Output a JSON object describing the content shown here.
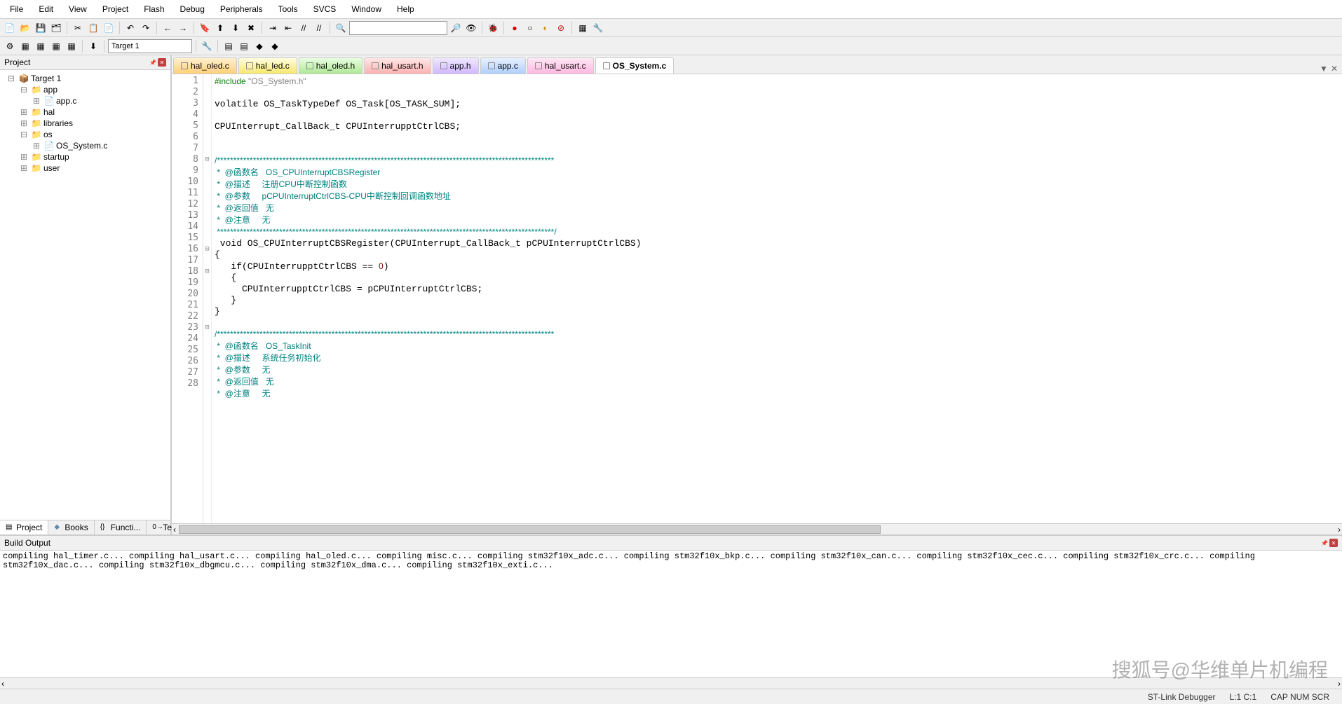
{
  "menu": {
    "items": [
      "File",
      "Edit",
      "View",
      "Project",
      "Flash",
      "Debug",
      "Peripherals",
      "Tools",
      "SVCS",
      "Window",
      "Help"
    ]
  },
  "toolbar1": {
    "labels": [
      "new",
      "open",
      "save",
      "saveall",
      "cut",
      "copy",
      "paste",
      "undo",
      "redo",
      "back",
      "fwd",
      "bookmark",
      "prev-bm",
      "next-bm",
      "clear-bm",
      "indent",
      "outdent",
      "comment",
      "uncomment",
      "find"
    ]
  },
  "toolbar2": {
    "target_combo": "Target 1"
  },
  "project": {
    "title": "Project",
    "root": "Target 1",
    "nodes": [
      {
        "lvl": 1,
        "label": "Target 1",
        "icon": "📦",
        "exp": "⊟"
      },
      {
        "lvl": 2,
        "label": "app",
        "icon": "📁",
        "exp": "⊟"
      },
      {
        "lvl": 3,
        "label": "app.c",
        "icon": "📄",
        "exp": "⊞"
      },
      {
        "lvl": 2,
        "label": "hal",
        "icon": "📁",
        "exp": "⊞"
      },
      {
        "lvl": 2,
        "label": "libraries",
        "icon": "📁",
        "exp": "⊞"
      },
      {
        "lvl": 2,
        "label": "os",
        "icon": "📁",
        "exp": "⊟"
      },
      {
        "lvl": 3,
        "label": "OS_System.c",
        "icon": "📄",
        "exp": "⊞"
      },
      {
        "lvl": 2,
        "label": "startup",
        "icon": "📁",
        "exp": "⊞"
      },
      {
        "lvl": 2,
        "label": "user",
        "icon": "📁",
        "exp": "⊞"
      }
    ],
    "bottom_tabs": [
      {
        "label": "Project",
        "active": true
      },
      {
        "label": "Books",
        "active": false
      },
      {
        "label": "Functi...",
        "active": false
      },
      {
        "label": "Templa...",
        "active": false
      }
    ]
  },
  "editor": {
    "tabs": [
      {
        "label": "hal_oled.c",
        "color": "c-orange"
      },
      {
        "label": "hal_led.c",
        "color": "c-yellow"
      },
      {
        "label": "hal_oled.h",
        "color": "c-green"
      },
      {
        "label": "hal_usart.h",
        "color": "c-red"
      },
      {
        "label": "app.h",
        "color": "c-purple"
      },
      {
        "label": "app.c",
        "color": "c-blue"
      },
      {
        "label": "hal_usart.c",
        "color": "c-pink"
      },
      {
        "label": "OS_System.c",
        "color": "c-grey",
        "active": true
      }
    ],
    "lines": 28,
    "fold": [
      "",
      "",
      "",
      "",
      "",
      "",
      "",
      "⊟",
      "",
      "",
      "",
      "",
      "",
      "",
      "",
      "⊟",
      "",
      "⊟",
      "",
      "",
      "",
      "",
      "⊟",
      "",
      "",
      "",
      "",
      ""
    ],
    "code": {
      "l1_pp": "#include",
      "l1_str": " \"OS_System.h\"",
      "l3": "volatile OS_TaskTypeDef OS_Task[OS_TASK_SUM];",
      "l5": "CPUInterrupt_CallBack_t CPUInterrupptCtrlCBS;",
      "l8": "/*******************************************************************************************************",
      "l9": " *  @函数名   OS_CPUInterruptCBSRegister",
      "l10": " *  @描述     注册CPU中断控制函数",
      "l11": " *  @参数     pCPUInterruptCtrlCBS-CPU中断控制回调函数地址",
      "l12": " *  @返回值   无",
      "l13": " *  @注意     无",
      "l14": " *******************************************************************************************************/",
      "l15a": " void OS_CPUInterruptCBSRegister(CPUInterrupt_CallBack_t pCPUInterruptCtrlCBS)",
      "l16": "{",
      "l17a": "   if(CPUInterrupptCtrlCBS == ",
      "l17n": "0",
      "l17b": ")",
      "l18": "   {",
      "l19": "     CPUInterrupptCtrlCBS = pCPUInterruptCtrlCBS;",
      "l20": "   }",
      "l21": "}",
      "l23": "/*******************************************************************************************************",
      "l24": " *  @函数名   OS_TaskInit",
      "l25": " *  @描述     系统任务初始化",
      "l26": " *  @参数     无",
      "l27": " *  @返回值   无",
      "l28": " *  @注意     无"
    }
  },
  "build": {
    "title": "Build Output",
    "lines": [
      "compiling hal_timer.c...",
      "compiling hal_usart.c...",
      "compiling hal_oled.c...",
      "compiling misc.c...",
      "compiling stm32f10x_adc.c...",
      "compiling stm32f10x_bkp.c...",
      "compiling stm32f10x_can.c...",
      "compiling stm32f10x_cec.c...",
      "compiling stm32f10x_crc.c...",
      "compiling stm32f10x_dac.c...",
      "compiling stm32f10x_dbgmcu.c...",
      "compiling stm32f10x_dma.c...",
      "compiling stm32f10x_exti.c..."
    ]
  },
  "status": {
    "debugger": "ST-Link Debugger",
    "pos": "L:1 C:1",
    "caps": "CAP  NUM  SCR"
  },
  "watermark": "搜狐号@华维单片机编程"
}
